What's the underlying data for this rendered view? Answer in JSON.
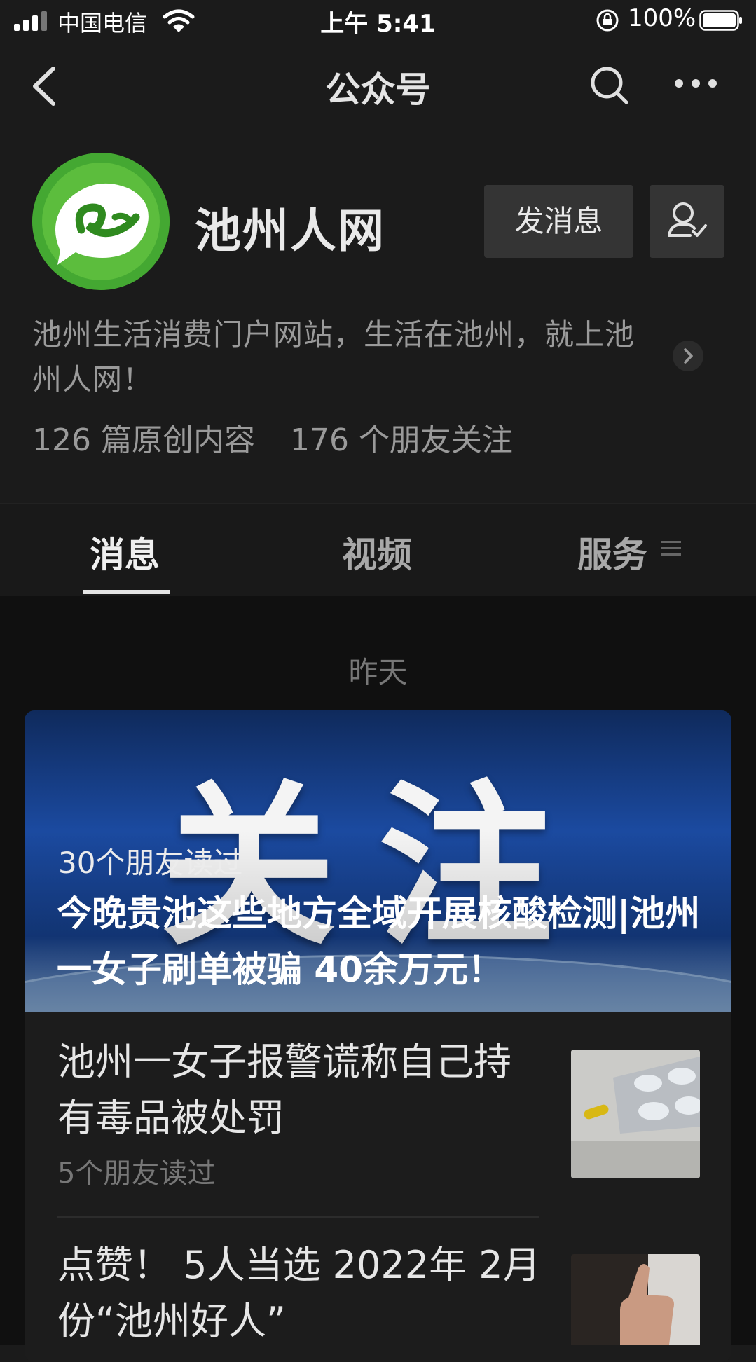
{
  "status_bar": {
    "carrier": "中国电信",
    "time": "上午 5:41",
    "battery": "100%"
  },
  "nav": {
    "title": "公众号"
  },
  "profile": {
    "name": "池州人网",
    "message_button": "发消息",
    "description": "池州生活消费门户网站，生活在池州，就上池州人网！",
    "stats": {
      "original": "126 篇原创内容",
      "friends": "176 个朋友关注"
    }
  },
  "tabs": [
    {
      "label": "消息",
      "active": true
    },
    {
      "label": "视频",
      "active": false
    },
    {
      "label": "服务",
      "active": false
    }
  ],
  "feed": {
    "date": "昨天",
    "featured": {
      "cover_text": "关注",
      "reads": "30个朋友读过",
      "title": "今晚贵池这些地方全域开展核酸检测|池州一女子刷单被骗 40余万元！"
    },
    "items": [
      {
        "title": "池州一女子报警谎称自己持有毒品被处罚",
        "reads": "5个朋友读过",
        "thumb": "pills-thumbnail"
      },
      {
        "title": "点赞！ 5人当选 2022年 2月份“池州好人”",
        "reads": "",
        "thumb": "thumbs-up-thumbnail"
      }
    ]
  },
  "colors": {
    "background": "#1b1b1b",
    "feed_background": "#101010",
    "brand_green": "#3a9a2a"
  }
}
